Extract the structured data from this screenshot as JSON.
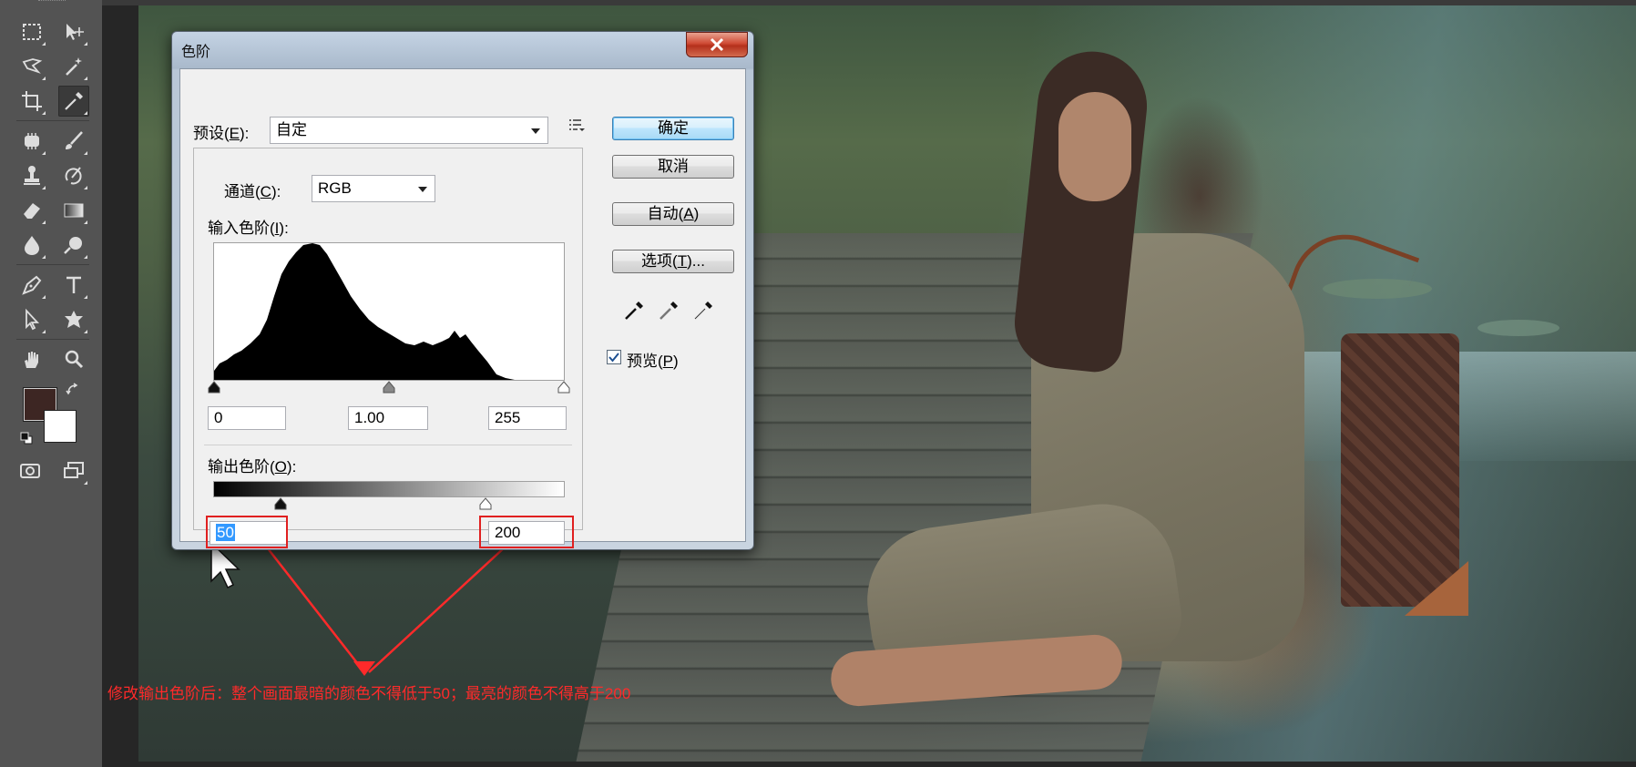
{
  "dialog": {
    "title": "色阶",
    "preset_label": "预设(",
    "preset_key": "E",
    "preset_suffix": "):",
    "preset_value": "自定",
    "channel_label": "通道(",
    "channel_key": "C",
    "channel_suffix": "):",
    "channel_value": "RGB",
    "input_levels_label": "输入色阶(",
    "input_levels_key": "I",
    "input_levels_suffix": "):",
    "input_black": "0",
    "input_gamma": "1.00",
    "input_white": "255",
    "output_levels_label": "输出色阶(",
    "output_levels_key": "O",
    "output_levels_suffix": "):",
    "output_black": "50",
    "output_white": "200",
    "ok_button": "确定",
    "cancel_button": "取消",
    "auto_label": "自动(",
    "auto_key": "A",
    "auto_suffix": ")",
    "options_label": "选项(",
    "options_key": "T",
    "options_suffix": ")...",
    "preview_label": "预览(",
    "preview_key": "P",
    "preview_suffix": ")",
    "preview_checked": true
  },
  "annotation": {
    "text": "修改输出色阶后：整个画面最暗的颜色不得低于50；最亮的颜色不得高于200",
    "color": "#ff2a2a"
  },
  "tools": {
    "foreground_color": "#3d2623",
    "background_color": "#ffffff"
  }
}
